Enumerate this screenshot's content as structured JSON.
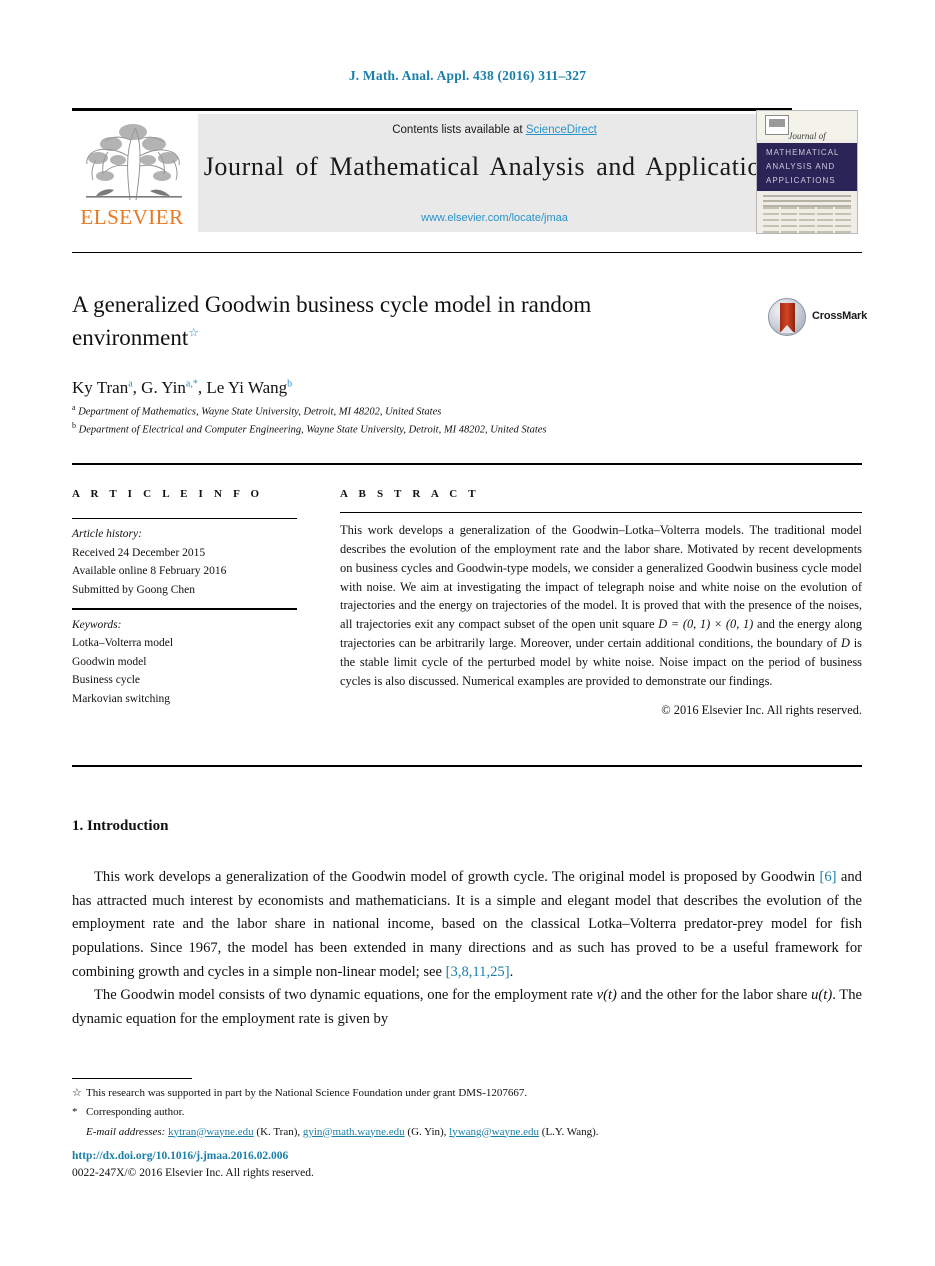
{
  "running_head": "J. Math. Anal. Appl. 438 (2016) 311–327",
  "masthead": {
    "contents_prefix": "Contents lists available at ",
    "sciencedirect": "ScienceDirect",
    "journal_title": "Journal of Mathematical Analysis and Applications",
    "journal_url": "www.elsevier.com/locate/jmaa",
    "publisher": "ELSEVIER",
    "cover": {
      "journal_of": "Journal of",
      "line1": "MATHEMATICAL",
      "line2": "ANALYSIS AND",
      "line3": "APPLICATIONS"
    }
  },
  "title": {
    "text": "A generalized Goodwin business cycle model in random environment",
    "footnote_marker": "☆"
  },
  "crossmark": {
    "label": "CrossMark"
  },
  "authors": {
    "list": "Ky Tran ª, G. Yin ª,*, Le Yi Wang ᵇ",
    "a1": "Ky Tran",
    "a1_sup": "a",
    "a2": "G. Yin",
    "a2_sup": "a,*",
    "a3": "Le Yi Wang",
    "a3_sup": "b"
  },
  "affiliations": [
    {
      "marker": "a",
      "text": "Department of Mathematics, Wayne State University, Detroit, MI 48202, United States"
    },
    {
      "marker": "b",
      "text": "Department of Electrical and Computer Engineering, Wayne State University, Detroit, MI 48202, United States"
    }
  ],
  "article_info": {
    "heading": "A R T I C L E   I N F O",
    "history_label": "Article history:",
    "received": "Received 24 December 2015",
    "available_online": "Available online 8 February 2016",
    "submitted_by": "Submitted by Goong Chen",
    "keywords_label": "Keywords:",
    "keywords": [
      "Lotka–Volterra model",
      "Goodwin model",
      "Business cycle",
      "Markovian switching"
    ]
  },
  "abstract": {
    "heading": "A B S T R A C T",
    "part1": "This work develops a generalization of the Goodwin–Lotka–Volterra models. The traditional model describes the evolution of the employment rate and the labor share. Motivated by recent developments on business cycles and Goodwin-type models, we consider a generalized Goodwin business cycle model with noise. We aim at investigating the impact of telegraph noise and white noise on the evolution of trajectories and the energy on trajectories of the model. It is proved that with the presence of the noises, all trajectories exit any compact subset of the open unit square ",
    "formula": "D = (0, 1) × (0, 1)",
    "part2": " and the energy along trajectories can be arbitrarily large. Moreover, under certain additional conditions, the boundary of ",
    "formula2": "D",
    "part3": " is the stable limit cycle of the perturbed model by white noise. Noise impact on the period of business cycles is also discussed. Numerical examples are provided to demonstrate our findings.",
    "copyright": "© 2016 Elsevier Inc. All rights reserved."
  },
  "introduction": {
    "heading": "1.  Introduction",
    "para1_a": "This work develops a generalization of the Goodwin model of growth cycle. The original model is proposed by Goodwin ",
    "ref1": "[6]",
    "para1_b": " and has attracted much interest by economists and mathematicians. It is a simple and elegant model that describes the evolution of the employment rate and the labor share in national income, based on the classical Lotka–Volterra predator-prey model for fish populations. Since 1967, the model has been extended in many directions and as such has proved to be a useful framework for combining growth and cycles in a simple non-linear model; see ",
    "ref2": "[3,8,11,25]",
    "para1_c": ".",
    "para2_a": "The Goodwin model consists of two dynamic equations, one for the employment rate ",
    "var_v": "v(t)",
    "para2_b": " and the other for the labor share ",
    "var_u": "u(t)",
    "para2_c": ". The dynamic equation for the employment rate is given by"
  },
  "footnotes": {
    "funding_marker": "☆",
    "funding": "This research was supported in part by the National Science Foundation under grant DMS-1207667.",
    "corresponding_marker": "*",
    "corresponding": "Corresponding author.",
    "email_label": "E-mail addresses:",
    "emails": [
      {
        "address": "kytran@wayne.edu",
        "person": "(K. Tran),"
      },
      {
        "address": "gyin@math.wayne.edu",
        "person": "(G. Yin),"
      },
      {
        "address": "lywang@wayne.edu",
        "person": "(L.Y. Wang)."
      }
    ]
  },
  "footer": {
    "doi": "http://dx.doi.org/10.1016/j.jmaa.2016.02.006",
    "issn": "0022-247X/© 2016 Elsevier Inc. All rights reserved."
  },
  "colors": {
    "link_blue": "#1a7fa8",
    "sciencedirect_blue": "#2a93c9",
    "elsevier_orange": "#e87722",
    "cover_navy": "#2b2456",
    "crossmark_red": "#d34524"
  }
}
